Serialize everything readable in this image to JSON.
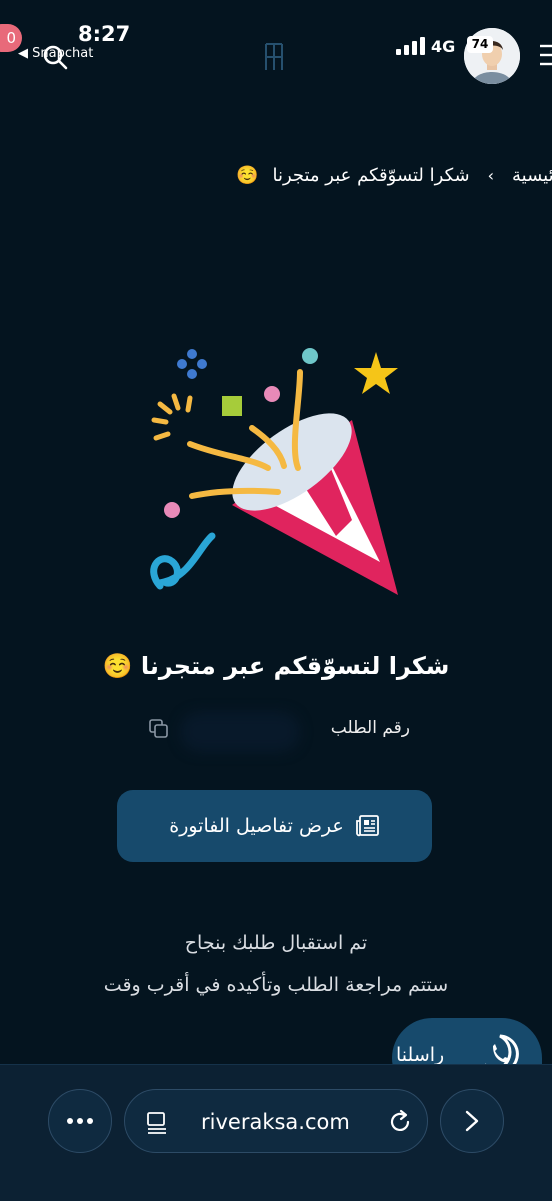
{
  "status_bar": {
    "time": "8:27",
    "back_app": "◀ Snapchat",
    "notification_count": "0",
    "network": "4G",
    "battery": "74"
  },
  "breadcrumb": {
    "home": "الرئيسية",
    "separator": "›",
    "current": "شكرا لتسوّقكم عبر متجرنا",
    "emoji": "☺️"
  },
  "confirmation": {
    "title": "شكرا لتسوّقكم عبر متجرنا",
    "emoji": "☺️",
    "order_label": "رقم الطلب"
  },
  "invoice_button": {
    "label": "عرض تفاصيل الفاتورة"
  },
  "messages": {
    "line1": "تم استقبال طلبك بنجاح",
    "line2": "ستتم مراجعة الطلب وتأكيده في أقرب وقت"
  },
  "contact_button": {
    "label": "راسلنا"
  },
  "browser": {
    "url": "riveraksa.com"
  },
  "colors": {
    "background": "#04141f",
    "button": "#174a6c",
    "toolbar": "#0c2133",
    "confetti_red": "#e0245e",
    "confetti_yellow": "#f5b942"
  }
}
